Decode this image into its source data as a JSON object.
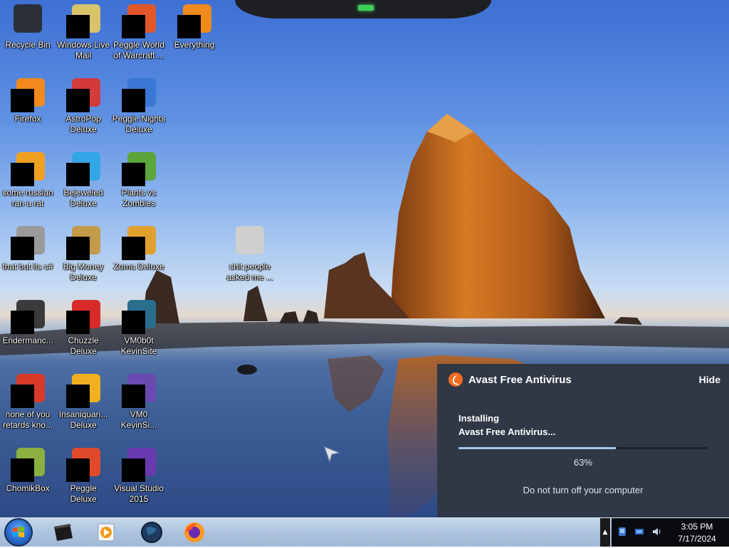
{
  "desktop": {
    "icons": [
      {
        "label": "Recycle Bin",
        "icon": "recycle-bin-icon",
        "color": "#2a2f38"
      },
      {
        "label": "Windows Live\nMail",
        "icon": "mail-icon",
        "color": "#d8c36a"
      },
      {
        "label": "Peggle World\nof Warcraft ...",
        "icon": "peggle-wow-icon",
        "color": "#e2572a"
      },
      {
        "label": "Everything",
        "icon": "everything-icon",
        "color": "#f08a1c"
      },
      {
        "label": "Firefox",
        "icon": "firefox-icon",
        "color": "#f28a1e"
      },
      {
        "label": "AstroPop\nDeluxe",
        "icon": "astropop-icon",
        "color": "#d43a3a"
      },
      {
        "label": "Peggle Nights\nDeluxe",
        "icon": "peggle-nights-icon",
        "color": "#3a78d4"
      },
      {
        "label": "some russian\nran a rat",
        "icon": "file-icon",
        "color": "#f0a020"
      },
      {
        "label": "Bejeweled\nDeluxe",
        "icon": "bejeweled-icon",
        "color": "#33a6e6"
      },
      {
        "label": "Plants vs\nZombies",
        "icon": "pvz-icon",
        "color": "#5aa63a"
      },
      {
        "label": "that but its c#",
        "icon": "shortcut-icon",
        "color": "#9a9a9a"
      },
      {
        "label": "Big Money\nDeluxe",
        "icon": "money-bag-icon",
        "color": "#c39a4a"
      },
      {
        "label": "Zuma Deluxe",
        "icon": "zuma-icon",
        "color": "#e0a030"
      },
      {
        "label": "shit people\nasked me ...",
        "icon": "folder-icon",
        "color": "#cfcfcf"
      },
      {
        "label": "Endermanc...",
        "icon": "app-icon",
        "color": "#3a3a3a"
      },
      {
        "label": "Chuzzle\nDeluxe",
        "icon": "chuzzle-icon",
        "color": "#d82a2a"
      },
      {
        "label": "VM0b0t\nKevinSite",
        "icon": "vm-icon",
        "color": "#2a6e8e"
      },
      {
        "label": "none of you\nretards kno...",
        "icon": "peggle-icon",
        "color": "#d83a2a"
      },
      {
        "label": "Insaniquari...\nDeluxe",
        "icon": "insaniquarium-icon",
        "color": "#f0b020"
      },
      {
        "label": "VM0\nKevinSi...",
        "icon": "vm-icon",
        "color": "#6a4ab0"
      },
      {
        "label": "ChomikBox",
        "icon": "chomikbox-icon",
        "color": "#8ab040"
      },
      {
        "label": "Peggle Deluxe",
        "icon": "peggle-icon",
        "color": "#e04a2a"
      },
      {
        "label": "Visual Studio\n2015",
        "icon": "visual-studio-icon",
        "color": "#6a3ab0"
      }
    ]
  },
  "avast": {
    "title": "Avast Free Antivirus",
    "hide_label": "Hide",
    "status_line1": "Installing",
    "status_line2": "Avast Free Antivirus...",
    "progress_fraction": 0.63,
    "percent_text": "63%",
    "warning": "Do not turn off your computer",
    "accent": "#f36a22"
  },
  "taskbar": {
    "pinned": [
      {
        "name": "taskbar-item-app1",
        "icon": "black-box-icon"
      },
      {
        "name": "taskbar-item-media-player",
        "icon": "media-player-icon"
      },
      {
        "name": "taskbar-item-globe",
        "icon": "globe-icon"
      },
      {
        "name": "taskbar-item-firefox",
        "icon": "firefox-icon"
      }
    ],
    "tray_arrow": "▲",
    "clock": {
      "time": "3:05 PM",
      "date": "7/17/2024"
    }
  }
}
